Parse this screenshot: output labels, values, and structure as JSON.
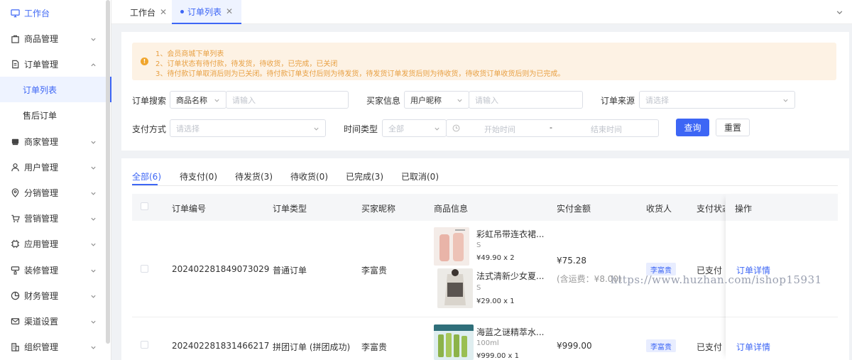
{
  "sidebar": {
    "items": [
      {
        "label": "工作台",
        "icon": "monitor-icon"
      },
      {
        "label": "商品管理",
        "icon": "bag-icon"
      },
      {
        "label": "订单管理",
        "icon": "document-icon"
      },
      {
        "label": "订单列表"
      },
      {
        "label": "售后订单"
      },
      {
        "label": "商家管理",
        "icon": "shop-icon"
      },
      {
        "label": "用户管理",
        "icon": "user-icon"
      },
      {
        "label": "分销管理",
        "icon": "location-icon"
      },
      {
        "label": "营销管理",
        "icon": "cart-icon"
      },
      {
        "label": "应用管理",
        "icon": "chip-icon"
      },
      {
        "label": "装修管理",
        "icon": "brush-icon"
      },
      {
        "label": "财务管理",
        "icon": "pie-icon"
      },
      {
        "label": "渠道设置",
        "icon": "mail-icon"
      },
      {
        "label": "组织管理",
        "icon": "building-icon"
      }
    ]
  },
  "tabs": [
    {
      "label": "工作台"
    },
    {
      "label": "订单列表"
    }
  ],
  "notice": {
    "lines": [
      "1、会员商城下单列表",
      "2、订单状态有待付款，待发货，待收货，已完成，已关闭",
      "3、待付款订单取消后则为已关闭。待付款订单支付后则为待发货，待发货订单发货后则为待收货，待收货订单收货后则为已完成。"
    ]
  },
  "filters": {
    "order_search_label": "订单搜索",
    "order_search_type": "商品名称",
    "order_search_placeholder": "请输入",
    "buyer_label": "买家信息",
    "buyer_type": "用户昵称",
    "buyer_placeholder": "请输入",
    "source_label": "订单来源",
    "source_placeholder": "请选择",
    "pay_label": "支付方式",
    "pay_placeholder": "请选择",
    "time_label": "时间类型",
    "time_type": "全部",
    "start_placeholder": "开始时间",
    "range_sep": "-",
    "end_placeholder": "结束时间",
    "query_button": "查询",
    "reset_button": "重置"
  },
  "status_tabs": [
    {
      "label": "全部(6)"
    },
    {
      "label": "待支付(0)"
    },
    {
      "label": "待发货(3)"
    },
    {
      "label": "待收货(0)"
    },
    {
      "label": "已完成(3)"
    },
    {
      "label": "已取消(0)"
    }
  ],
  "table": {
    "columns": [
      "订单编号",
      "订单类型",
      "买家昵称",
      "商品信息",
      "实付金额",
      "收货人",
      "支付状态",
      "操作"
    ],
    "rows": [
      {
        "order_no": "202402281849073029",
        "type": "普通订单",
        "buyer": "李富贵",
        "products": [
          {
            "name": "彩虹吊带连衣裙...",
            "sku": "S",
            "price_qty": "¥49.90   x 2"
          },
          {
            "name": "法式清新少女夏...",
            "sku": "S",
            "price_qty": "¥29.00   x 1"
          }
        ],
        "amount": "¥75.28",
        "shipping": "(含运费：¥8.00)",
        "receiver": "李富贵",
        "pay_status": "已支付",
        "action": "订单详情"
      },
      {
        "order_no": "202402281831466217",
        "type": "拼团订单 (拼团成功)",
        "buyer": "李富贵",
        "products": [
          {
            "name": "海蓝之谜精萃水...",
            "sku": "100ml",
            "price_qty": "¥999.00   x 1"
          }
        ],
        "amount": "¥999.00",
        "receiver": "李富贵",
        "pay_status": "已支付",
        "action": "订单详情"
      }
    ]
  },
  "watermark": "https://www.huzhan.com/ishop15931"
}
